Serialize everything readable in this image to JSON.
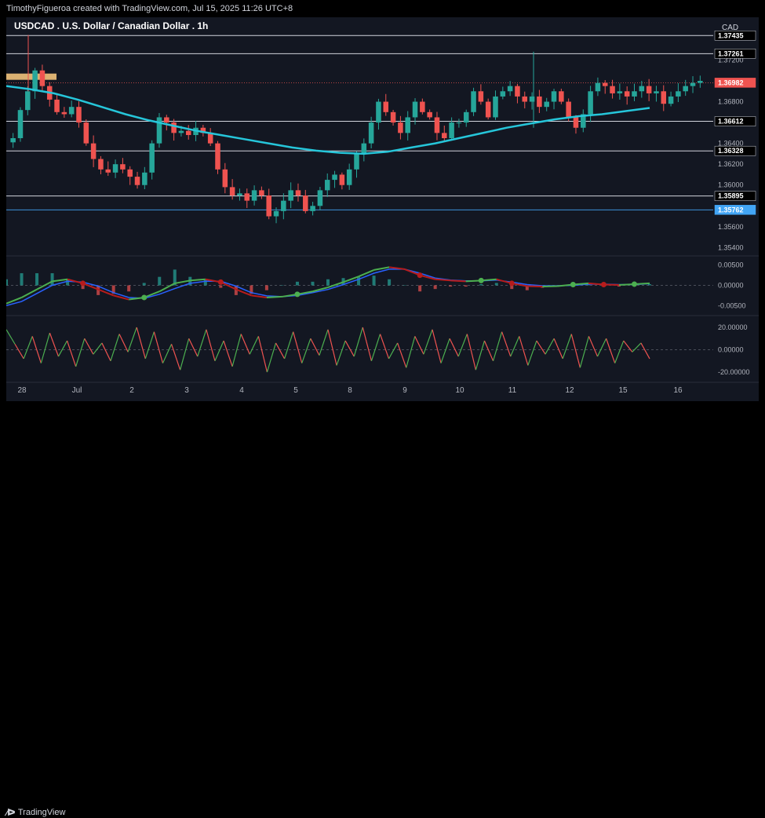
{
  "header": {
    "attribution": "TimothyFigueroa created with TradingView.com, Jul 15, 2025 11:26 UTC+8"
  },
  "footer": {
    "logo_text": "TradingView"
  },
  "colors": {
    "background": "#131722",
    "up_candle": "#26a69a",
    "down_candle": "#ef5350",
    "moving_average": "#26c6da",
    "level_line": "#d1d4dc",
    "current_price_line": "#ef5350",
    "blue_level": "#42a5f5",
    "macd_green": "#4caf50",
    "macd_red": "#b71c1c",
    "macd_blue": "#2962ff",
    "highlight_box": "#ffcc80"
  },
  "chart_data": [
    {
      "type": "candlestick",
      "title": "USDCAD . U.S. Dollar / Canadian Dollar . 1h",
      "currency_label": "CAD",
      "ylim": [
        1.3535,
        1.3755
      ],
      "y_ticks": [
        "1.37200",
        "1.36800",
        "1.36400",
        "1.36200",
        "1.36000",
        "1.35600",
        "1.35400"
      ],
      "x_tick_labels": [
        "28",
        "Jul",
        "2",
        "3",
        "4",
        "5",
        "8",
        "9",
        "10",
        "11",
        "12",
        "15",
        "16"
      ],
      "horizontal_levels": [
        {
          "value": 1.37435,
          "label": "1.37435",
          "style": "dark"
        },
        {
          "value": 1.37261,
          "label": "1.37261",
          "style": "dark"
        },
        {
          "value": 1.36982,
          "label": "1.36982",
          "style": "current"
        },
        {
          "value": 1.36612,
          "label": "1.36612",
          "style": "dark"
        },
        {
          "value": 1.36328,
          "label": "1.36328",
          "style": "dark"
        },
        {
          "value": 1.35895,
          "label": "1.35895",
          "style": "dark"
        },
        {
          "value": 1.35762,
          "label": "1.35762",
          "style": "blue"
        }
      ],
      "price_path_close": [
        1.3645,
        1.3672,
        1.369,
        1.371,
        1.3695,
        1.3682,
        1.367,
        1.3668,
        1.3675,
        1.366,
        1.364,
        1.3625,
        1.3615,
        1.3612,
        1.362,
        1.3615,
        1.3608,
        1.36,
        1.3612,
        1.364,
        1.3665,
        1.366,
        1.365,
        1.3652,
        1.3648,
        1.3655,
        1.365,
        1.364,
        1.3615,
        1.3598,
        1.359,
        1.3592,
        1.3585,
        1.3595,
        1.359,
        1.357,
        1.3575,
        1.3585,
        1.3595,
        1.359,
        1.3575,
        1.358,
        1.3595,
        1.3605,
        1.361,
        1.36,
        1.3615,
        1.363,
        1.364,
        1.366,
        1.368,
        1.367,
        1.366,
        1.365,
        1.3665,
        1.368,
        1.367,
        1.3665,
        1.365,
        1.3645,
        1.366,
        1.366,
        1.367,
        1.369,
        1.368,
        1.3665,
        1.3685,
        1.369,
        1.3695,
        1.3685,
        1.368,
        1.3685,
        1.3675,
        1.368,
        1.369,
        1.368,
        1.3665,
        1.3655,
        1.3668,
        1.369,
        1.3698,
        1.3695,
        1.3688,
        1.369,
        1.3685,
        1.369,
        1.3695,
        1.3688,
        1.369,
        1.3678,
        1.3685,
        1.369,
        1.3695,
        1.3698,
        1.37
      ],
      "moving_average_path": [
        1.3695,
        1.3692,
        1.3688,
        1.3682,
        1.3675,
        1.3668,
        1.3662,
        1.3657,
        1.3652,
        1.3648,
        1.3644,
        1.364,
        1.3636,
        1.3633,
        1.3631,
        1.363,
        1.3632,
        1.3636,
        1.364,
        1.3645,
        1.365,
        1.3655,
        1.3659,
        1.3663,
        1.3666,
        1.3668,
        1.3671,
        1.3674
      ]
    },
    {
      "type": "line",
      "name_hidden": true,
      "ylim": [
        -0.0065,
        0.0065
      ],
      "y_ticks": [
        "0.00500",
        "0.00000",
        "-0.00500"
      ],
      "series_a": [
        -0.0045,
        -0.003,
        -0.001,
        0.001,
        0.0015,
        0.0005,
        -0.001,
        -0.0025,
        -0.0035,
        -0.003,
        -0.0015,
        0.0005,
        0.0012,
        0.0015,
        0.0008,
        -0.001,
        -0.0025,
        -0.003,
        -0.0028,
        -0.0022,
        -0.0015,
        -0.0005,
        0.0008,
        0.0022,
        0.0038,
        0.0045,
        0.004,
        0.0025,
        0.0015,
        0.0012,
        0.001,
        0.0012,
        0.0015,
        0.0005,
        -0.0002,
        -0.0003,
        -0.0002,
        0.0002,
        0.0005,
        0.0002,
        0.0001,
        0.0003,
        0.0005
      ],
      "series_b": [
        -0.005,
        -0.004,
        -0.002,
        0.0,
        0.001,
        0.0008,
        -0.0002,
        -0.0018,
        -0.003,
        -0.0032,
        -0.0022,
        -0.0008,
        0.0005,
        0.001,
        0.001,
        -0.0002,
        -0.0018,
        -0.0026,
        -0.0028,
        -0.0025,
        -0.0018,
        -0.001,
        0.0002,
        0.0015,
        0.003,
        0.004,
        0.004,
        0.003,
        0.0018,
        0.0013,
        0.0011,
        0.0011,
        0.0013,
        0.0008,
        0.0002,
        -0.0001,
        -0.0001,
        0.0,
        0.0003,
        0.0003,
        0.0002,
        0.0002,
        0.0004
      ]
    },
    {
      "type": "line",
      "ylim": [
        -27,
        27
      ],
      "y_ticks": [
        "20.00000",
        "0.00000",
        "-20.00000"
      ],
      "values": [
        18,
        5,
        -8,
        12,
        -12,
        15,
        -6,
        8,
        -15,
        10,
        -4,
        6,
        -10,
        14,
        -2,
        20,
        -8,
        16,
        -12,
        5,
        -18,
        10,
        -6,
        18,
        -10,
        8,
        -15,
        14,
        -4,
        12,
        -20,
        6,
        -8,
        16,
        -12,
        10,
        -5,
        18,
        -14,
        8,
        -6,
        20,
        -10,
        14,
        -8,
        6,
        -16,
        12,
        -4,
        18,
        -12,
        10,
        -6,
        14,
        -18,
        8,
        -10,
        16,
        -6,
        12,
        -14,
        8,
        -4,
        10,
        -8,
        14,
        -16,
        12,
        -6,
        10,
        -12,
        8,
        -2,
        6,
        -8
      ]
    }
  ]
}
